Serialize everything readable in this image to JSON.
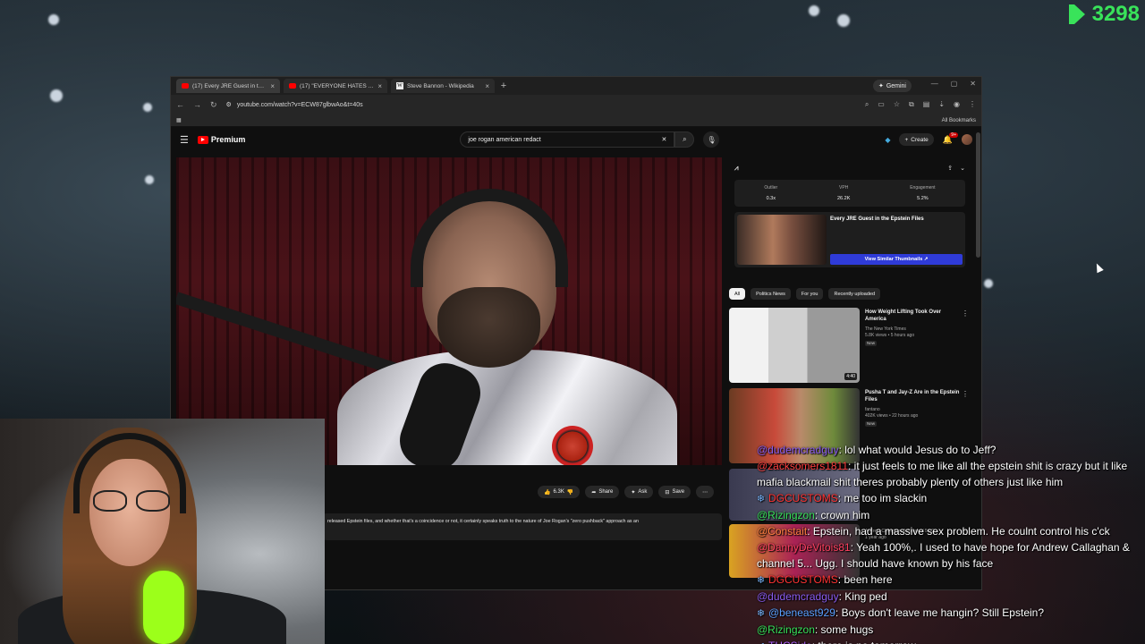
{
  "overlay": {
    "counter": "3298"
  },
  "browser": {
    "tabs": [
      {
        "title": "(17) Every JRE Guest in the Epstein Files",
        "icon": "youtube-icon",
        "active": true
      },
      {
        "title": "(17) \"EVERYONE HATES YOU!\"",
        "icon": "youtube-icon",
        "active": false
      },
      {
        "title": "Steve Bannon - Wikipedia",
        "icon": "wikipedia-icon",
        "active": false
      }
    ],
    "gemini_label": "Gemini",
    "url": "youtube.com/watch?v=ECW87glbwAo&t=40s",
    "bookmarks_label": "All Bookmarks"
  },
  "youtube": {
    "logo": "Premium",
    "search_value": "joe rogan american redact",
    "create_label": "Create",
    "notif_count": "9+",
    "actions": {
      "likes": "6.3K",
      "share": "Share",
      "ask": "Ask",
      "save": "Save"
    },
    "description": "released Epstein files, and whether that's a coincidence or not, it certainly speaks truth to the nature of Joe Rogan's \"zero pushback\" approach as an"
  },
  "extension": {
    "stats": [
      {
        "label": "Outlier",
        "value": "0.3x"
      },
      {
        "label": "VPH",
        "value": "26.2K"
      },
      {
        "label": "Engagement",
        "value": "5.2%"
      }
    ],
    "card_title": "Every JRE Guest in the Epstein Files",
    "similar_label": "View Similar Thumbnails"
  },
  "chips": [
    "All",
    "Politics News",
    "For you",
    "Recently uploaded"
  ],
  "recommendations": [
    {
      "title": "How Weight Lifting Took Over America",
      "channel": "The New York Times",
      "meta": "5.8K views • 5 hours ago",
      "badge": "New",
      "duration": "4:40"
    },
    {
      "title": "Pusha T and Jay-Z Are in the Epstein Files",
      "channel": "fantano",
      "meta": "402K views • 22 hours ago",
      "badge": "New",
      "duration": ""
    },
    {
      "title": "",
      "channel": "",
      "meta": "",
      "badge": "",
      "duration": ""
    },
    {
      "title": "",
      "channel": "Andrew Callaghan & Channel 5 | O...",
      "meta": "1 year ago",
      "badge": "",
      "duration": ""
    }
  ],
  "chat": [
    {
      "prefix": "",
      "name": "@dudemcradguy",
      "color": "#8a5cf0",
      "text": ": lol what would Jesus do to Jeff?"
    },
    {
      "prefix": "",
      "name": "@zacksomers1811",
      "color": "#ff4040",
      "text": ": it just feels to me like all the epstein shit is crazy but it like mafia blackmail shit theres probably plenty of others just like him"
    },
    {
      "prefix": "❄",
      "name": "DGCUSTOMS",
      "color": "#ff3333",
      "text": ": me too im slackin"
    },
    {
      "prefix": "",
      "name": "@Rizingzon",
      "color": "#38e05a",
      "text": ": crown him"
    },
    {
      "prefix": "",
      "name": "@Constait",
      "color": "#ff8040",
      "text": ": Epstein, had a massive sex problem. He coulnt control his c'ck"
    },
    {
      "prefix": "",
      "name": "@DannyDeVitois81",
      "color": "#ff4060",
      "text": ": Yeah 100%,. I used to have hope for Andrew Callaghan & channel 5... Ugg. I should have known by his face"
    },
    {
      "prefix": "❄",
      "name": "DGCUSTOMS",
      "color": "#ff3333",
      "text": ": been here"
    },
    {
      "prefix": "",
      "name": "@dudemcradguy",
      "color": "#8a5cf0",
      "text": ": King ped"
    },
    {
      "prefix": "❄",
      "name": "@beneast929",
      "color": "#5aa0ff",
      "text": ": Boys don't leave me hangin? Still Epstein?"
    },
    {
      "prefix": "",
      "name": "@Rizingzon",
      "color": "#38e05a",
      "text": ": some hugs"
    },
    {
      "prefix": "✔",
      "name": "THCSide",
      "color": "#b060ff",
      "text": ": there is no tomorrow"
    }
  ]
}
